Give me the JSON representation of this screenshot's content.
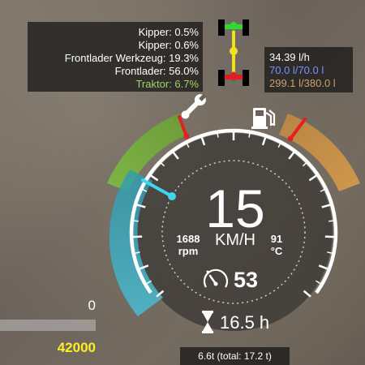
{
  "wear": {
    "lines": [
      {
        "label": "Kipper: 0.5%",
        "color": "#ffffff"
      },
      {
        "label": "Kipper: 0.6%",
        "color": "#ffffff"
      },
      {
        "label": "Frontlader Werkzeug: 19.3%",
        "color": "#ffffff"
      },
      {
        "label": "Frontlader: 56.0%",
        "color": "#ffffff"
      },
      {
        "label": "Traktor: 6.7%",
        "color": "#9fd46a"
      }
    ]
  },
  "fuel": {
    "rate": "34.39 l/h",
    "def_level": "70.0 l/70.0 l",
    "fuel_level": "299.1 l/380.0 l",
    "def_color": "#7f8fff",
    "fuel_color": "#c9a36a"
  },
  "gauge": {
    "speed": "15",
    "speed_unit": "KM/H",
    "rpm": "1688",
    "rpm_unit": "rpm",
    "temp": "91",
    "temp_unit": "°C",
    "cruise_speed": "53",
    "operating_hours": "16.5 h",
    "wear_gauge_color": "#7ab43a",
    "fuel_gauge_color": "#c08a40",
    "rpm_gauge_color": "#3aa4b4",
    "needle_red": "#e52020",
    "needle_cyan": "#3fd7f0",
    "wrench_icon": "wrench-icon",
    "fuel_icon": "fuel-pump-icon",
    "cruise_icon": "cruise-control-icon",
    "hours_icon": "hourglass-icon"
  },
  "mass": {
    "text": "6.6t (total: 17.2 t)"
  },
  "money": {
    "current": "0",
    "total": "42000",
    "fill_fraction": 0.0
  },
  "axle": {
    "icon": "axle-steering-icon",
    "front_color": "#33d633",
    "rear_color": "#e02020",
    "shaft_color": "#f0e020"
  }
}
